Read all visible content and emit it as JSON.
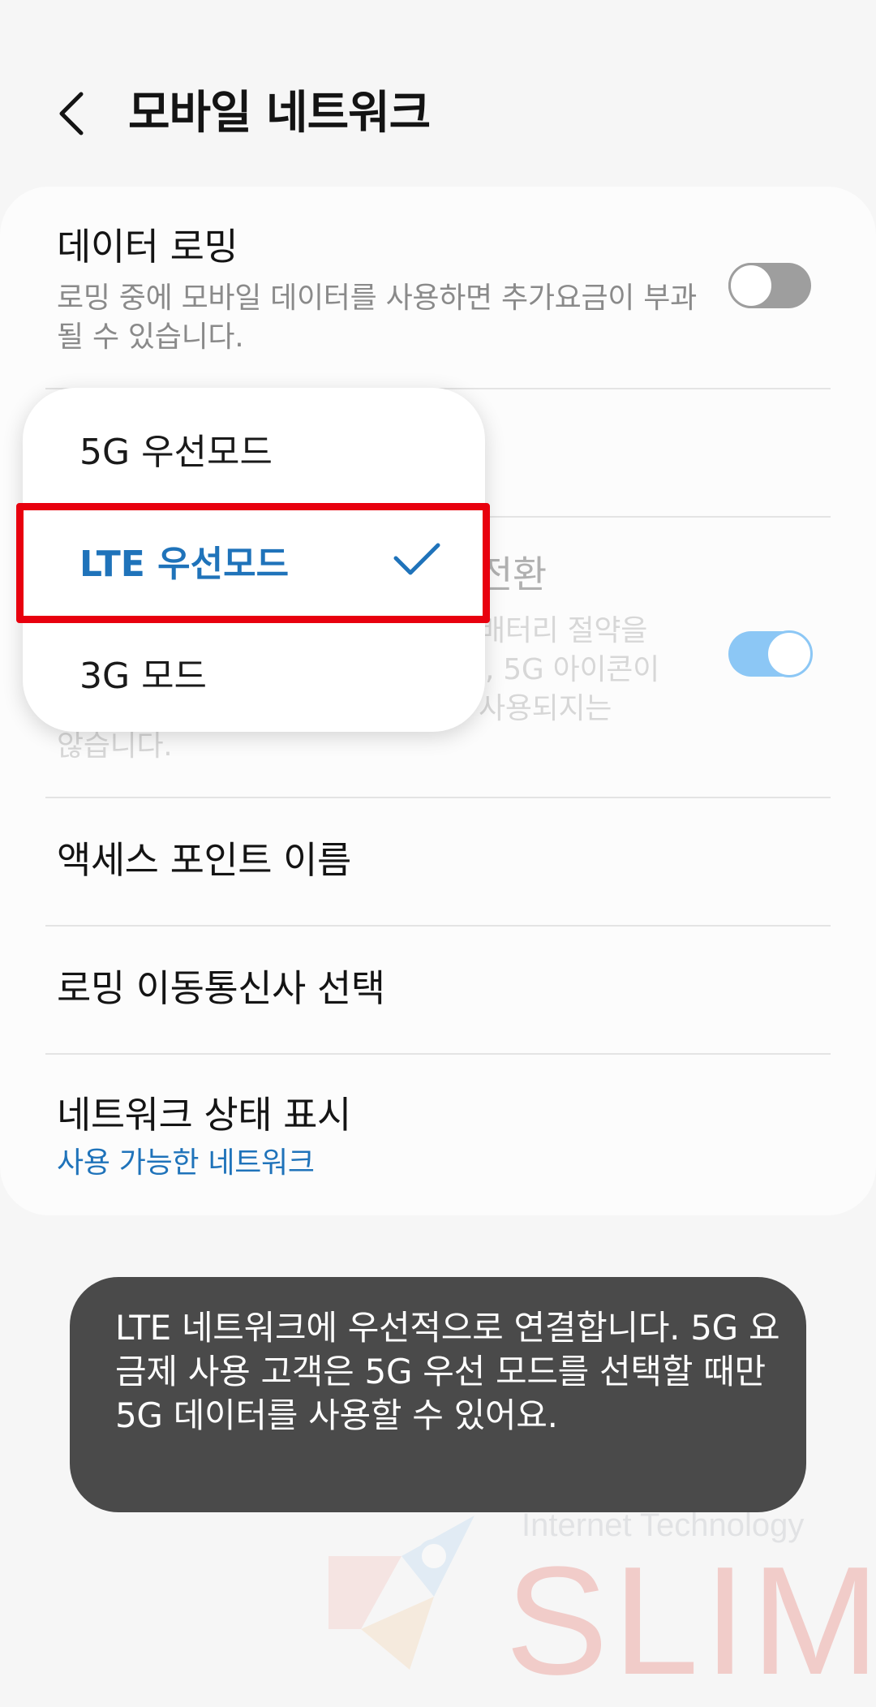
{
  "header": {
    "back_label": "<",
    "title": "모바일 네트워크"
  },
  "settings": {
    "data_roaming": {
      "title": "데이터 로밍",
      "subtitle": "로밍 중에 모바일 데이터를 사용하면 추가요금이 부과될 수 있습니다.",
      "enabled": false
    },
    "smart_switch": {
      "title_fragment": "전환",
      "subtitle_fragments": [
        "배터리 절약을",
        ", 5G 아이콘이",
        "사용되지는",
        "않습니다."
      ],
      "enabled": true
    },
    "access_point_name": {
      "title": "액세스 포인트 이름"
    },
    "roaming_carrier": {
      "title": "로밍 이동통신사 선택"
    },
    "network_status": {
      "title": "네트워크 상태 표시",
      "value": "사용 가능한 네트워크"
    }
  },
  "network_mode_popup": {
    "options": [
      {
        "label": "5G 우선모드",
        "selected": false
      },
      {
        "label": "LTE 우선모드",
        "selected": true
      },
      {
        "label": "3G 모드",
        "selected": false
      }
    ]
  },
  "toast": {
    "message": "LTE 네트워크에 우선적으로 연결합니다. 5G 요금제 사용 고객은 5G 우선 모드를 선택할 때만 5G 데이터를 사용할 수 있어요."
  },
  "watermark": {
    "subtitle": "Internet Technology",
    "brand": "SLIM"
  },
  "colors": {
    "accent_blue": "#1f73ba",
    "toggle_on": "#3f9aef",
    "highlight_red": "#e8000e",
    "toast_bg": "#4a4a4a"
  }
}
